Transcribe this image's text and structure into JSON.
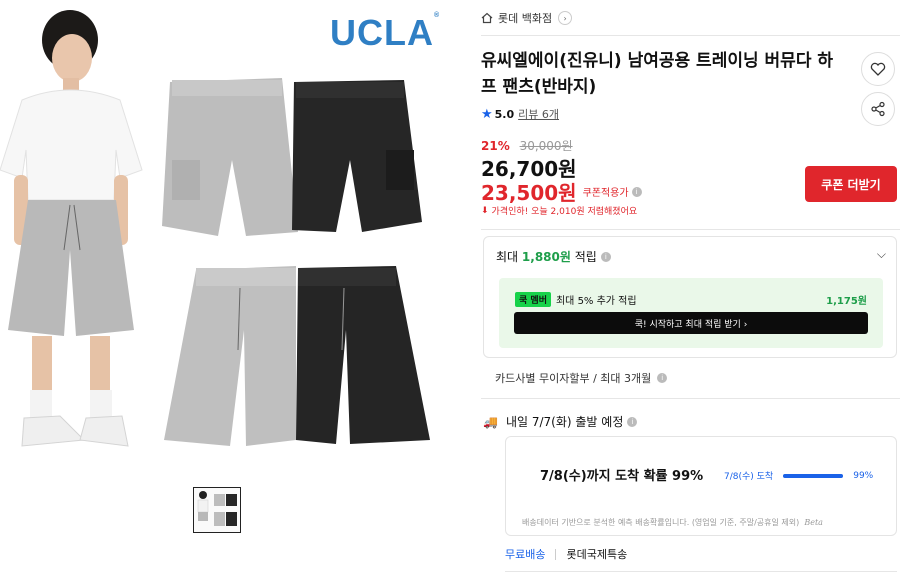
{
  "brand_logo": "UCLA",
  "breadcrumb": {
    "store": "롯데 백화점"
  },
  "product": {
    "title": "유씨엘에이(진유니) 남여공용 트레이닝 버뮤다 하프 팬츠(반바지)",
    "rating": "5.0",
    "review": "리뷰 6개",
    "discount_rate": "21%",
    "original_price": "30,000원",
    "price": "26,700원",
    "coupon_price": "23,500원",
    "coupon_label": "쿠폰적용가",
    "price_drop_note": "가격인하! 오늘 2,010원 저렴해졌어요",
    "coupon_button": "쿠폰 더받기"
  },
  "points": {
    "head_prefix": "최대 ",
    "head_amount": "1,880원",
    "head_suffix": " 적립",
    "badge_prefix": "쿡",
    "badge": "멤버",
    "member_text": "최대 5% 추가 적립",
    "member_amount": "1,175원",
    "member_button": "쿡! 시작하고 최대 적립 받기  ›"
  },
  "installment": "카드사별 무이자할부 / 최대 3개월",
  "shipping": {
    "head": "내일 7/7(화) 출발 예정",
    "eta_main": "7/8(수)까지 도착 확률 99%",
    "eta_label": "7/8(수) 도착",
    "eta_percent": "99%",
    "eta_fraction": 0.99,
    "note": "배송데이터 기반으로 분석한 예측 배송확률입니다. (영업일 기준, 주말/공휴일 제외)",
    "beta": "Beta",
    "free_shipping": "무료배송",
    "carrier": "롯데국제특송"
  },
  "colors": {
    "accent_red": "#e0262c",
    "accent_blue": "#1a62e8",
    "point_green": "#1e9e4a",
    "brand_blue": "#2f7fc4"
  }
}
